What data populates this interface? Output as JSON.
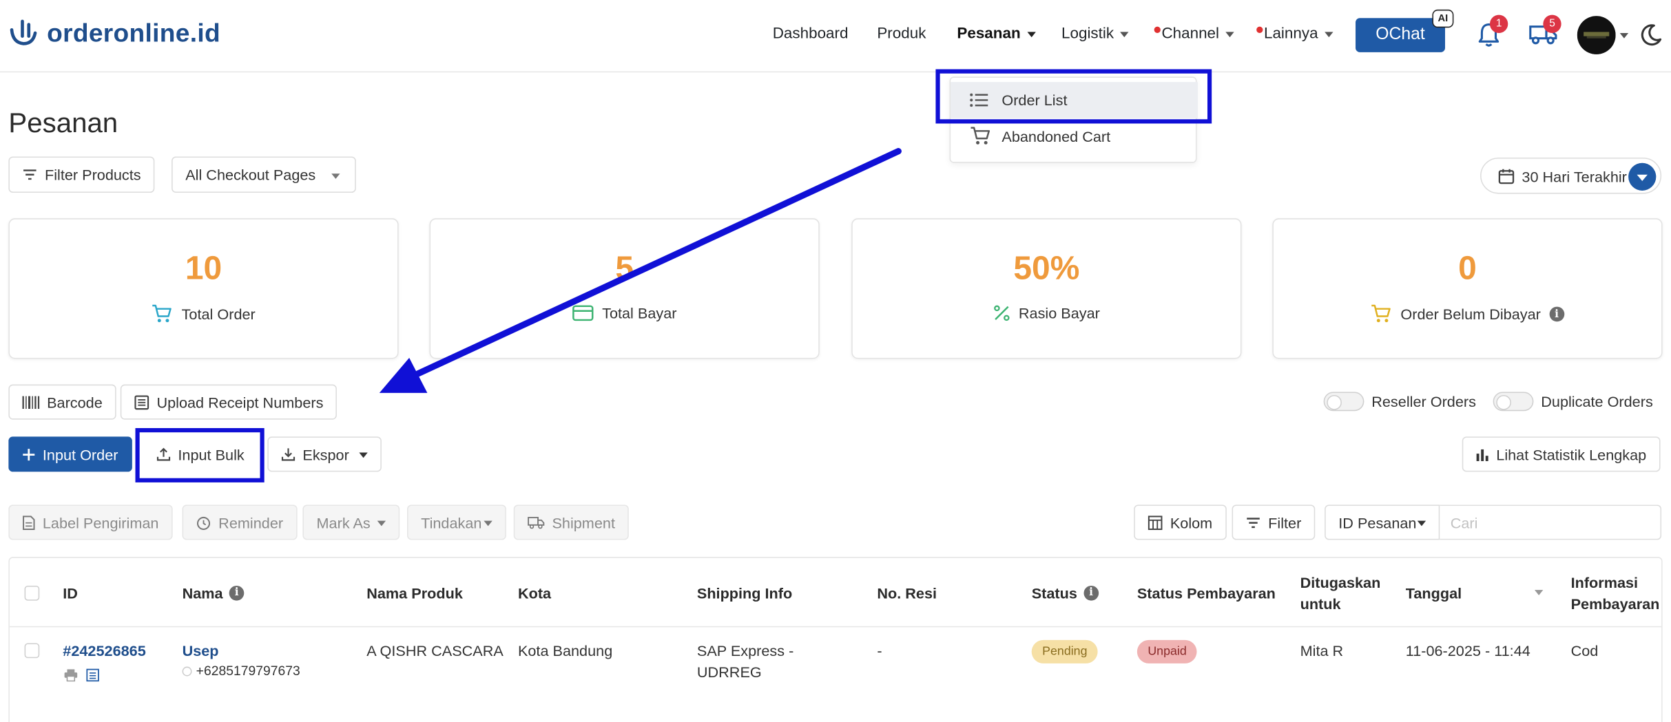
{
  "brand": {
    "name": "orderonline.id",
    "color": "#1f4e8c"
  },
  "nav": {
    "dashboard": "Dashboard",
    "produk": "Produk",
    "pesanan": "Pesanan",
    "logistik": "Logistik",
    "channel": "Channel",
    "lainnya": "Lainnya",
    "ochat": "OChat",
    "ai_badge": "AI",
    "notif_count": "1",
    "shipping_count": "5",
    "icons": [
      "bell-icon",
      "truck-icon",
      "moon-icon"
    ]
  },
  "pesanan_menu": {
    "items": [
      "Order List",
      "Abandoned Cart"
    ],
    "active": "Order List"
  },
  "page": {
    "title": "Pesanan"
  },
  "filters": {
    "filter_products": "Filter Products",
    "checkout_pages": "All Checkout Pages",
    "date_range": "30 Hari Terakhir"
  },
  "stats": [
    {
      "value": "10",
      "label": "Total Order",
      "icon": "cart-icon"
    },
    {
      "value": "5",
      "label": "Total Bayar",
      "icon": "card-icon"
    },
    {
      "value": "50%",
      "label": "Rasio Bayar",
      "icon": "percent-icon"
    },
    {
      "value": "0",
      "label": "Order Belum Dibayar",
      "icon": "cart-icon"
    }
  ],
  "toolbar1": {
    "barcode": "Barcode",
    "upload_receipt": "Upload Receipt Numbers",
    "reseller_orders": "Reseller Orders",
    "duplicate_orders": "Duplicate Orders"
  },
  "toolbar2": {
    "input_order": "Input Order",
    "input_bulk": "Input Bulk",
    "ekspor": "Ekspor",
    "lihat_statistik": "Lihat Statistik Lengkap"
  },
  "toolbar3": {
    "label_pengiriman": "Label Pengiriman",
    "reminder": "Reminder",
    "mark_as": "Mark As",
    "tindakan": "Tindakan",
    "shipment": "Shipment",
    "kolom": "Kolom",
    "filter": "Filter",
    "search_field": "ID Pesanan",
    "search_placeholder": "Cari"
  },
  "table": {
    "headers": [
      "ID",
      "Nama",
      "Nama Produk",
      "Kota",
      "Shipping Info",
      "No. Resi",
      "Status",
      "Status Pembayaran",
      "Ditugaskan untuk",
      "Tanggal",
      "Informasi Pembayaran"
    ],
    "rows": [
      {
        "id": "#242526865",
        "nama": "Usep",
        "phone": "+6285179797673",
        "produk": "A QISHR CASCARA",
        "kota": "Kota Bandung",
        "shipping_line1": "SAP Express -",
        "shipping_line2": "UDRREG",
        "resi": "-",
        "status": "Pending",
        "status_pembayaran": "Unpaid",
        "ditugaskan": "Mita R",
        "tanggal": "11-06-2025 - 11:44",
        "informasi": "Cod"
      }
    ]
  },
  "colors": {
    "primary": "#1f5aa6",
    "stat_value": "#ef9a3c",
    "highlight": "#1010d6",
    "pending_bg": "#f6e0a6",
    "unpaid_bg": "#f0b3b3"
  }
}
